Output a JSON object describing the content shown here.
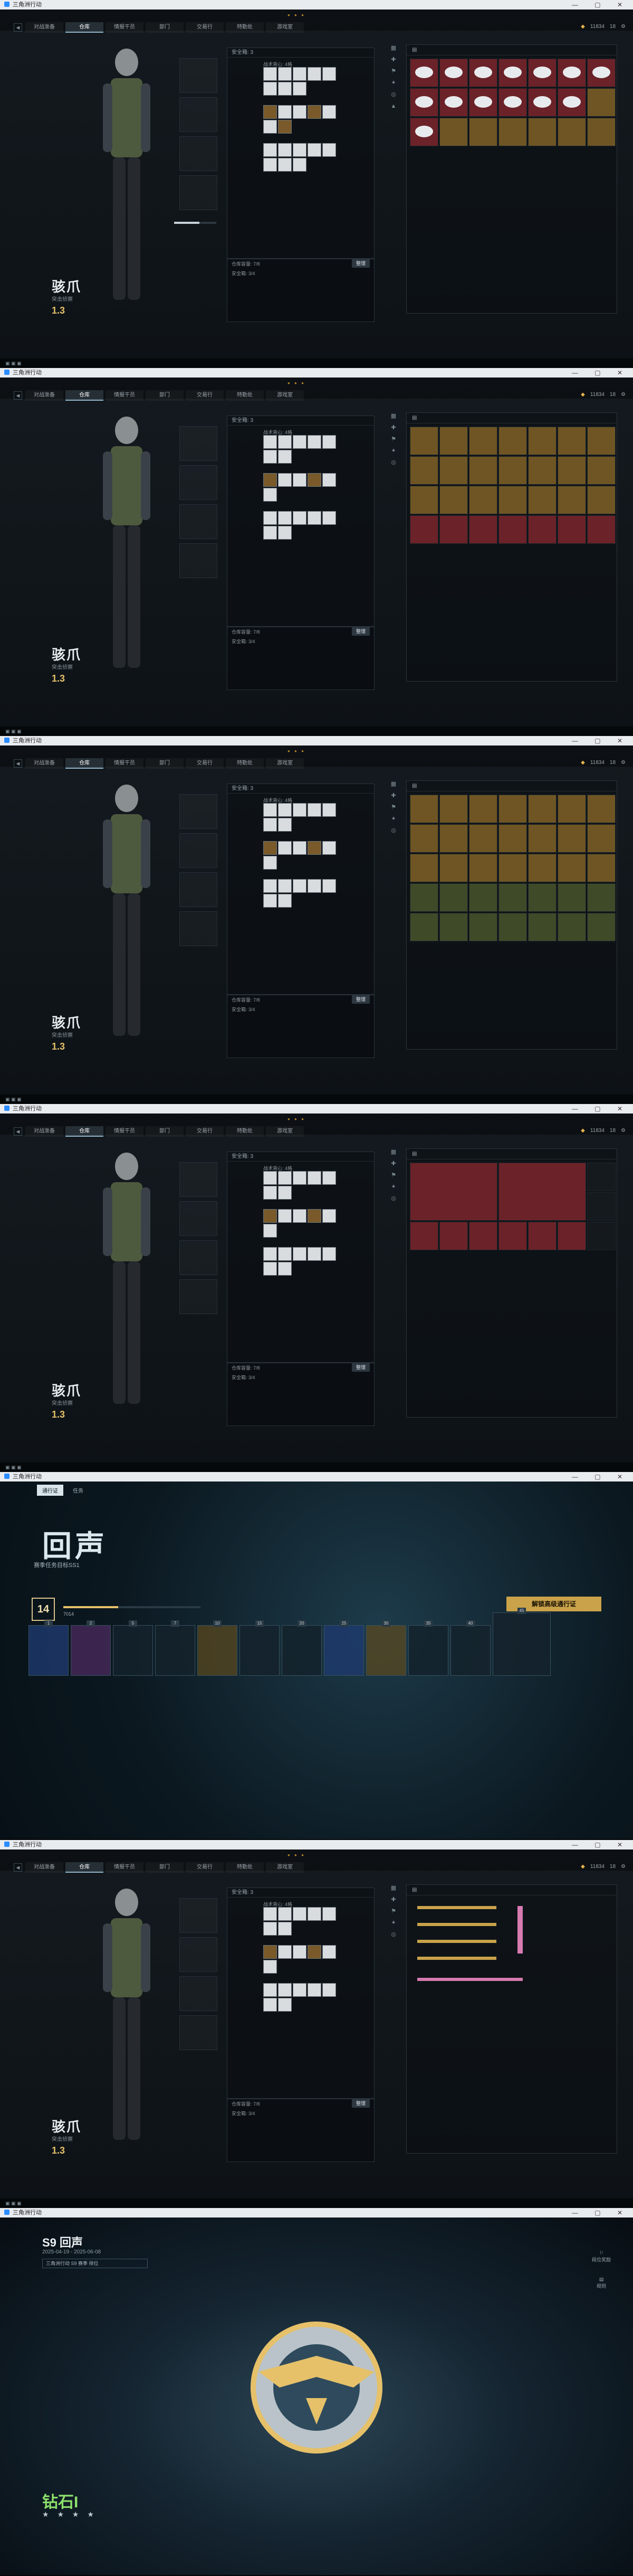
{
  "window": {
    "title": "三角洲行动"
  },
  "warehouse": {
    "tabs": [
      "对战准备",
      "仓库",
      "情报干员",
      "部门",
      "交易行",
      "特勤处",
      "游戏室"
    ],
    "active_tab": "仓库",
    "currency_1": "11834",
    "currency_2": "18",
    "operator_name": "骇爪",
    "operator_role": "突击侦察",
    "operator_level": "1.3",
    "safebox_label": "安全箱: 3",
    "safebox_head": "战术背心: 4格",
    "bottom_label": "仓库容量: 7/8",
    "bottom_btn": "整理",
    "secure_label": "安全箱: 3/4"
  },
  "battlepass": {
    "tabs": [
      "通行证",
      "任务"
    ],
    "title": "回声",
    "subtitle": "赛季任务目标SS1",
    "level": "14",
    "exp_text": "7014",
    "unlock_btn": "解锁高级通行证",
    "reward_levels": [
      "1",
      "2",
      "5",
      "7",
      "10",
      "15",
      "20",
      "25",
      "30",
      "35",
      "40",
      "45"
    ]
  },
  "rank": {
    "season": "S9 回声",
    "date": "2025-04-19 - 2025-06-08",
    "pill": "三角洲行动 S9 赛季 排位",
    "rank_name": "钻石I",
    "stars": "★ ★ ★ ★",
    "side_1": "段位奖励",
    "side_2": "规则"
  }
}
